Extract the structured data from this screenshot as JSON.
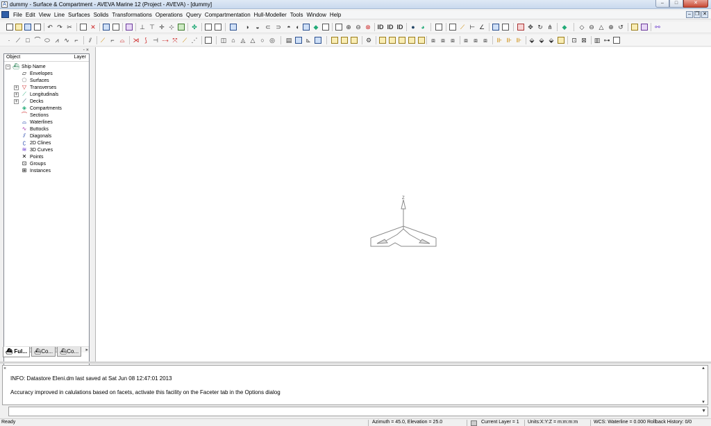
{
  "window": {
    "title": "dummy - Surface & Compartment - AVEVA Marine 12 (Project - AVEVA) - [dummy]",
    "icon_name": "aveva-app-icon",
    "buttons": {
      "minimize": "–",
      "maximize": "□",
      "close": "✕"
    }
  },
  "menubar": {
    "items": [
      "File",
      "Edit",
      "View",
      "Line",
      "Surfaces",
      "Solids",
      "Transformations",
      "Operations",
      "Query",
      "Compartmentation",
      "Hull-Modeller",
      "Tools",
      "Window",
      "Help"
    ],
    "mdi_buttons": {
      "minimize": "–",
      "restore": "❐",
      "close": "✕"
    }
  },
  "toolbar1": {
    "icons": [
      "new-icon",
      "open-icon",
      "save-icon",
      "print-icon",
      "undo-icon",
      "redo-icon",
      "delete-icon",
      "copy-icon",
      "cut-icon",
      "properties-icon",
      "layer-icon",
      "grid-icon",
      "mirror-icon",
      "view-icon",
      "zoom-in-icon",
      "zoom-out-icon",
      "zoom-window-icon",
      "id-icon",
      "shade-icon",
      "surface-icon",
      "rotate-icon",
      "pan-icon",
      "compartment-icon"
    ],
    "text_buttons": [
      "ID",
      "ID",
      "ID"
    ]
  },
  "toolbar2": {
    "icons": [
      "point-icon",
      "line-icon",
      "rectangle-icon",
      "arc-icon",
      "ellipse-icon",
      "spline-icon",
      "trim-icon",
      "extend-icon",
      "offset-icon",
      "solid-box-icon",
      "solid-cylinder-icon",
      "solid-cone-icon",
      "solid-sphere-icon",
      "boolean-icon",
      "faceting-icon",
      "section-icon"
    ]
  },
  "tree_panel": {
    "header": {
      "object": "Object",
      "layer": "Layer"
    },
    "root": {
      "label": "Ship Name",
      "icon": "ship-icon",
      "expander": "−"
    },
    "items": [
      {
        "label": "Envelopes",
        "icon": "envelope-icon",
        "expander": ""
      },
      {
        "label": "Surfaces",
        "icon": "surface-icon",
        "expander": ""
      },
      {
        "label": "Transverses",
        "icon": "transverse-icon",
        "expander": "+"
      },
      {
        "label": "Longitudinals",
        "icon": "longitudinal-icon",
        "expander": "+"
      },
      {
        "label": "Decks",
        "icon": "deck-icon",
        "expander": "+"
      },
      {
        "label": "Compartments",
        "icon": "compartment-icon",
        "expander": ""
      },
      {
        "label": "Sections",
        "icon": "section-icon",
        "expander": ""
      },
      {
        "label": "Waterlines",
        "icon": "waterline-icon",
        "expander": ""
      },
      {
        "label": "Buttocks",
        "icon": "buttock-icon",
        "expander": ""
      },
      {
        "label": "Diagonals",
        "icon": "diagonal-icon",
        "expander": ""
      },
      {
        "label": "2D Clines",
        "icon": "2d-cline-icon",
        "expander": ""
      },
      {
        "label": "3D Curves",
        "icon": "3d-curve-icon",
        "expander": ""
      },
      {
        "label": "Points",
        "icon": "point-cross-icon",
        "expander": ""
      },
      {
        "label": "Groups",
        "icon": "group-icon",
        "expander": ""
      },
      {
        "label": "Instances",
        "icon": "instance-icon",
        "expander": ""
      }
    ],
    "panel_controls": "- ×",
    "tabs": [
      "Ful...",
      "Co...",
      "Co..."
    ]
  },
  "canvas": {
    "axis_label": "Z"
  },
  "output": {
    "close_glyph": "×",
    "lines": [
      "INFO: Datastore Eleni.dm last saved at Sat Jun 08 12:47:01 2013",
      "Accuracy improved in calulations based on facets, activate this facility on the Faceter tab in the Options dialog"
    ],
    "command_value": ""
  },
  "statusbar": {
    "ready": "Ready",
    "view": "Azimuth = 45.0, Elevation = 25.0",
    "layer": "Current Layer = 1",
    "units": "Units:X:Y:Z = m:m:m:m",
    "wcs": "WCS: Waterline = 0.000",
    "rollback": "Rollback History: 0/0"
  },
  "colors": {
    "title_bar": "#c9d9ee",
    "canvas_bg": "#ffffff",
    "panel_bg": "#f0f0f0",
    "close_button": "#c84a35"
  }
}
